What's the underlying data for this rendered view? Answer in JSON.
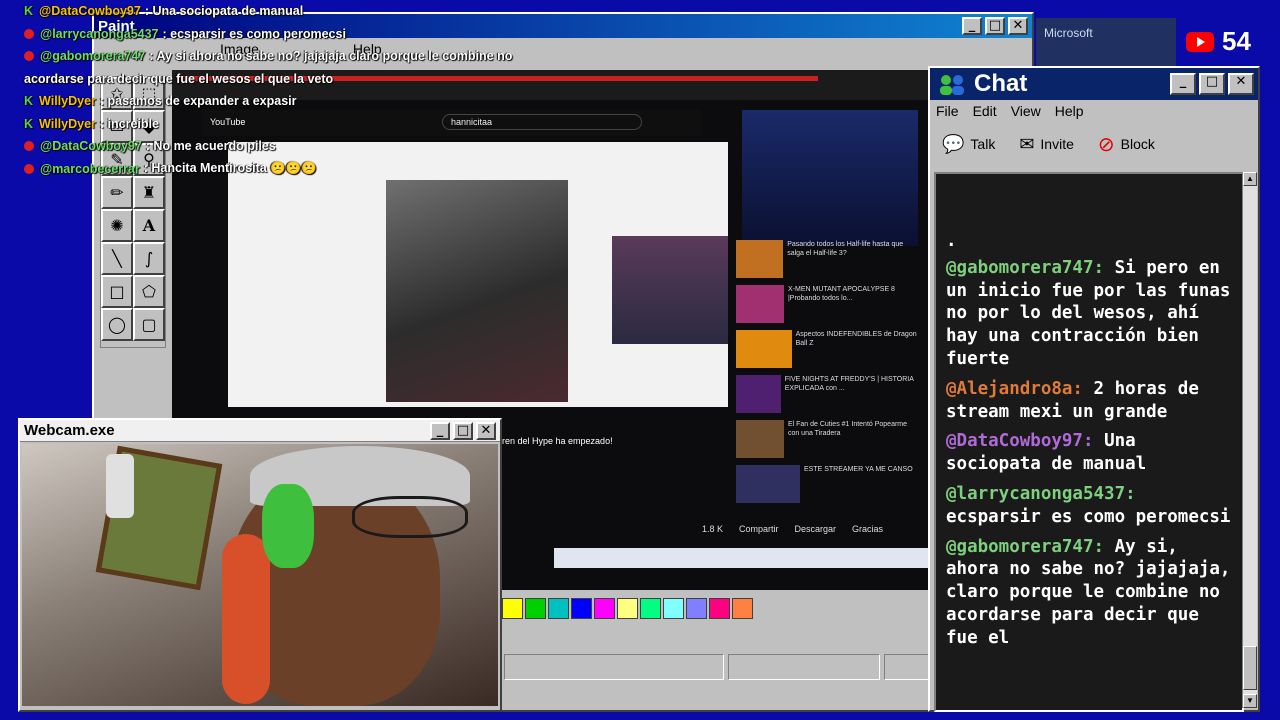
{
  "paint": {
    "title": "Paint",
    "menu": [
      "Image",
      "Help"
    ],
    "tools": [
      "select-star",
      "select-rect",
      "eraser",
      "fill",
      "pick",
      "zoom",
      "pencil",
      "brush",
      "airbrush",
      "text",
      "line",
      "curve",
      "rect",
      "poly",
      "ellipse",
      "roundrect"
    ],
    "palette": [
      "#ffff00",
      "#00d000",
      "#00c0c0",
      "#0000ff",
      "#ff00ff",
      "#ffff80",
      "#00ff80",
      "#80ffff",
      "#8080ff",
      "#ff0080",
      "#ff8040"
    ]
  },
  "youtube": {
    "url": "www.youtube.com/watch",
    "search": "hannicitaa",
    "logo": "YouTube",
    "below_title": "ren del Hype ha empezado!",
    "likes": "1.8 K",
    "actions": [
      "Compartir",
      "Descargar",
      "Gracias"
    ],
    "recs": [
      "Pasando todos los Half-life hasta que salga el Half-life 3?",
      "X-MEN MUTANT APOCALYPSE 8 |Probando todos lo...",
      "Aspectos INDEFENDIBLES de Dragon Ball Z",
      "FIVE NIGHTS AT FREDDY'S | HISTORIA EXPLICADA con ...",
      "El Fan de Cuties #1 Intentó Popearme con una Tiradera",
      "ESTE STREAMER YA ME CANSO"
    ]
  },
  "overlay": [
    {
      "user": "@DataCowboy97",
      "text": ": Una sociopata de manual",
      "badge": "k"
    },
    {
      "user": "@larrycanonga5437",
      "text": ": ecsparsir es como peromecsi",
      "badge": "yt"
    },
    {
      "user": "@gabomorera747",
      "text": ": Ay si ahora no sabe no? jajajaja claro porque le combine no",
      "badge": "yt"
    },
    {
      "user": "",
      "text": "acordarse para decir que fue el wesos el que la veto",
      "badge": ""
    },
    {
      "user": "WillyDyer",
      "text": ": pasamos de expander a expasir",
      "badge": "k"
    },
    {
      "user": "WillyDyer",
      "text": ": increible",
      "badge": "k"
    },
    {
      "user": "@DataCowboy97",
      "text": ": No me acuerdo piles",
      "badge": "yt"
    },
    {
      "user": "@marcobecerrar",
      "text": ": Hancita Mentirosita 😕😕😕",
      "badge": "yt2"
    }
  ],
  "webcam": {
    "title": "Webcam.exe"
  },
  "chat": {
    "title": "Chat",
    "menu": [
      "File",
      "Edit",
      "View",
      "Help"
    ],
    "tools": [
      "Talk",
      "Invite",
      "Block"
    ],
    "messages": [
      {
        "user": "@gabomorera747:",
        "color": "#7ed07e",
        "text": "Si pero en un inicio fue por las funas no por lo del wesos, ahí hay una contracción bien fuerte"
      },
      {
        "user": "@Alejandro8a:",
        "color": "#e07a3a",
        "text": "2 horas de stream mexi un grande"
      },
      {
        "user": "@DataCowboy97:",
        "color": "#b06ad8",
        "text": "Una sociopata de manual"
      },
      {
        "user": "@larrycanonga5437:",
        "color": "#7ed07e",
        "text": "ecsparsir es como peromecsi"
      },
      {
        "user": "@gabomorera747:",
        "color": "#7ed07e",
        "text": "Ay si, ahora no sabe no? jajajaja, claro porque le combine no acordarse para decir que fue el"
      }
    ]
  },
  "viewers": {
    "count": "54",
    "bg_window": "Microsoft"
  }
}
